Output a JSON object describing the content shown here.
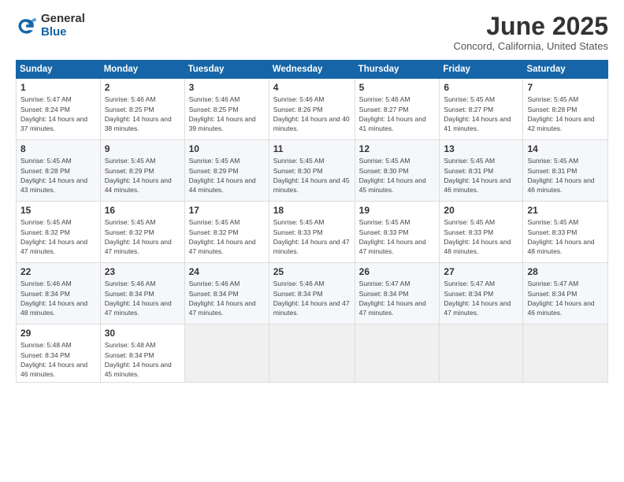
{
  "logo": {
    "general": "General",
    "blue": "Blue"
  },
  "title": "June 2025",
  "subtitle": "Concord, California, United States",
  "weekdays": [
    "Sunday",
    "Monday",
    "Tuesday",
    "Wednesday",
    "Thursday",
    "Friday",
    "Saturday"
  ],
  "weeks": [
    [
      {
        "day": "1",
        "sunrise": "5:47 AM",
        "sunset": "8:24 PM",
        "daylight": "14 hours and 37 minutes."
      },
      {
        "day": "2",
        "sunrise": "5:46 AM",
        "sunset": "8:25 PM",
        "daylight": "14 hours and 38 minutes."
      },
      {
        "day": "3",
        "sunrise": "5:46 AM",
        "sunset": "8:25 PM",
        "daylight": "14 hours and 39 minutes."
      },
      {
        "day": "4",
        "sunrise": "5:46 AM",
        "sunset": "8:26 PM",
        "daylight": "14 hours and 40 minutes."
      },
      {
        "day": "5",
        "sunrise": "5:46 AM",
        "sunset": "8:27 PM",
        "daylight": "14 hours and 41 minutes."
      },
      {
        "day": "6",
        "sunrise": "5:45 AM",
        "sunset": "8:27 PM",
        "daylight": "14 hours and 41 minutes."
      },
      {
        "day": "7",
        "sunrise": "5:45 AM",
        "sunset": "8:28 PM",
        "daylight": "14 hours and 42 minutes."
      }
    ],
    [
      {
        "day": "8",
        "sunrise": "5:45 AM",
        "sunset": "8:28 PM",
        "daylight": "14 hours and 43 minutes."
      },
      {
        "day": "9",
        "sunrise": "5:45 AM",
        "sunset": "8:29 PM",
        "daylight": "14 hours and 44 minutes."
      },
      {
        "day": "10",
        "sunrise": "5:45 AM",
        "sunset": "8:29 PM",
        "daylight": "14 hours and 44 minutes."
      },
      {
        "day": "11",
        "sunrise": "5:45 AM",
        "sunset": "8:30 PM",
        "daylight": "14 hours and 45 minutes."
      },
      {
        "day": "12",
        "sunrise": "5:45 AM",
        "sunset": "8:30 PM",
        "daylight": "14 hours and 45 minutes."
      },
      {
        "day": "13",
        "sunrise": "5:45 AM",
        "sunset": "8:31 PM",
        "daylight": "14 hours and 46 minutes."
      },
      {
        "day": "14",
        "sunrise": "5:45 AM",
        "sunset": "8:31 PM",
        "daylight": "14 hours and 46 minutes."
      }
    ],
    [
      {
        "day": "15",
        "sunrise": "5:45 AM",
        "sunset": "8:32 PM",
        "daylight": "14 hours and 47 minutes."
      },
      {
        "day": "16",
        "sunrise": "5:45 AM",
        "sunset": "8:32 PM",
        "daylight": "14 hours and 47 minutes."
      },
      {
        "day": "17",
        "sunrise": "5:45 AM",
        "sunset": "8:32 PM",
        "daylight": "14 hours and 47 minutes."
      },
      {
        "day": "18",
        "sunrise": "5:45 AM",
        "sunset": "8:33 PM",
        "daylight": "14 hours and 47 minutes."
      },
      {
        "day": "19",
        "sunrise": "5:45 AM",
        "sunset": "8:33 PM",
        "daylight": "14 hours and 47 minutes."
      },
      {
        "day": "20",
        "sunrise": "5:45 AM",
        "sunset": "8:33 PM",
        "daylight": "14 hours and 48 minutes."
      },
      {
        "day": "21",
        "sunrise": "5:45 AM",
        "sunset": "8:33 PM",
        "daylight": "14 hours and 48 minutes."
      }
    ],
    [
      {
        "day": "22",
        "sunrise": "5:46 AM",
        "sunset": "8:34 PM",
        "daylight": "14 hours and 48 minutes."
      },
      {
        "day": "23",
        "sunrise": "5:46 AM",
        "sunset": "8:34 PM",
        "daylight": "14 hours and 47 minutes."
      },
      {
        "day": "24",
        "sunrise": "5:46 AM",
        "sunset": "8:34 PM",
        "daylight": "14 hours and 47 minutes."
      },
      {
        "day": "25",
        "sunrise": "5:46 AM",
        "sunset": "8:34 PM",
        "daylight": "14 hours and 47 minutes."
      },
      {
        "day": "26",
        "sunrise": "5:47 AM",
        "sunset": "8:34 PM",
        "daylight": "14 hours and 47 minutes."
      },
      {
        "day": "27",
        "sunrise": "5:47 AM",
        "sunset": "8:34 PM",
        "daylight": "14 hours and 47 minutes."
      },
      {
        "day": "28",
        "sunrise": "5:47 AM",
        "sunset": "8:34 PM",
        "daylight": "14 hours and 46 minutes."
      }
    ],
    [
      {
        "day": "29",
        "sunrise": "5:48 AM",
        "sunset": "8:34 PM",
        "daylight": "14 hours and 46 minutes."
      },
      {
        "day": "30",
        "sunrise": "5:48 AM",
        "sunset": "8:34 PM",
        "daylight": "14 hours and 45 minutes."
      },
      null,
      null,
      null,
      null,
      null
    ]
  ]
}
